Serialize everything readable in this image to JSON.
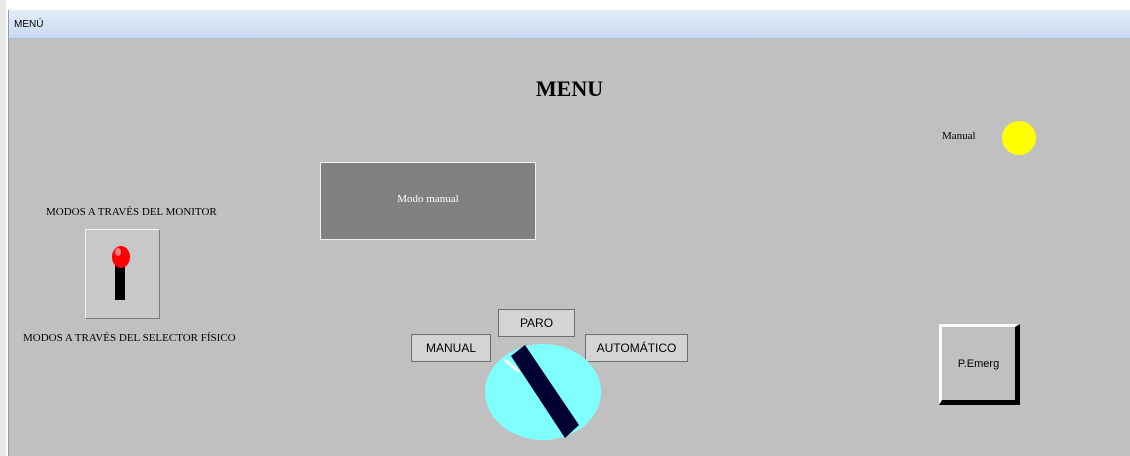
{
  "window": {
    "title": "MENÚ"
  },
  "page": {
    "heading": "MENU"
  },
  "indicator": {
    "label": "Manual",
    "lamp_color": "#ffff00"
  },
  "mode_panel": {
    "label": "Modo manual"
  },
  "monitor_mode": {
    "label": "MODOS A TRAVÉS DEL MONITOR"
  },
  "physical_mode": {
    "label": "MODOS A TRAVÉS DEL SELECTOR FÍSICO"
  },
  "selector": {
    "paro_label": "PARO",
    "manual_label": "MANUAL",
    "auto_label": "AUTOMÁTICO",
    "knob_color": "#80ffff",
    "position": "manual"
  },
  "emergency": {
    "label": "P.Emerg"
  }
}
